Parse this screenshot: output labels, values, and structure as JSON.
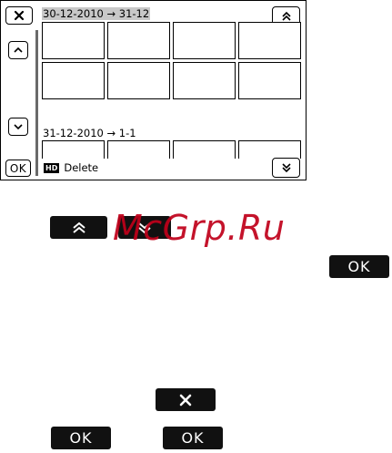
{
  "screen": {
    "close_button_icon": "close-icon",
    "ok_label": "OK",
    "group1_date": "30-12-2010 → 31-12",
    "group2_date": "31-12-2010 → 1-1",
    "hd_badge": "HD",
    "delete_label": "Delete",
    "scroll_up_icon": "chevron-up-icon",
    "scroll_down_icon": "chevron-down-icon",
    "page_up_icon": "double-chevron-up-icon",
    "page_down_icon": "double-chevron-down-icon"
  },
  "below": {
    "watermark": "McGrp.Ru",
    "page_up_icon": "double-chevron-up-icon",
    "page_down_icon": "double-chevron-down-icon",
    "ok_label_right": "OK",
    "close_icon": "close-icon",
    "ok_label_left": "OK",
    "ok_label_mid": "OK"
  },
  "colors": {
    "watermark": "#c0001a",
    "button_fill": "#111111",
    "date_highlight": "#c8c8c8"
  }
}
